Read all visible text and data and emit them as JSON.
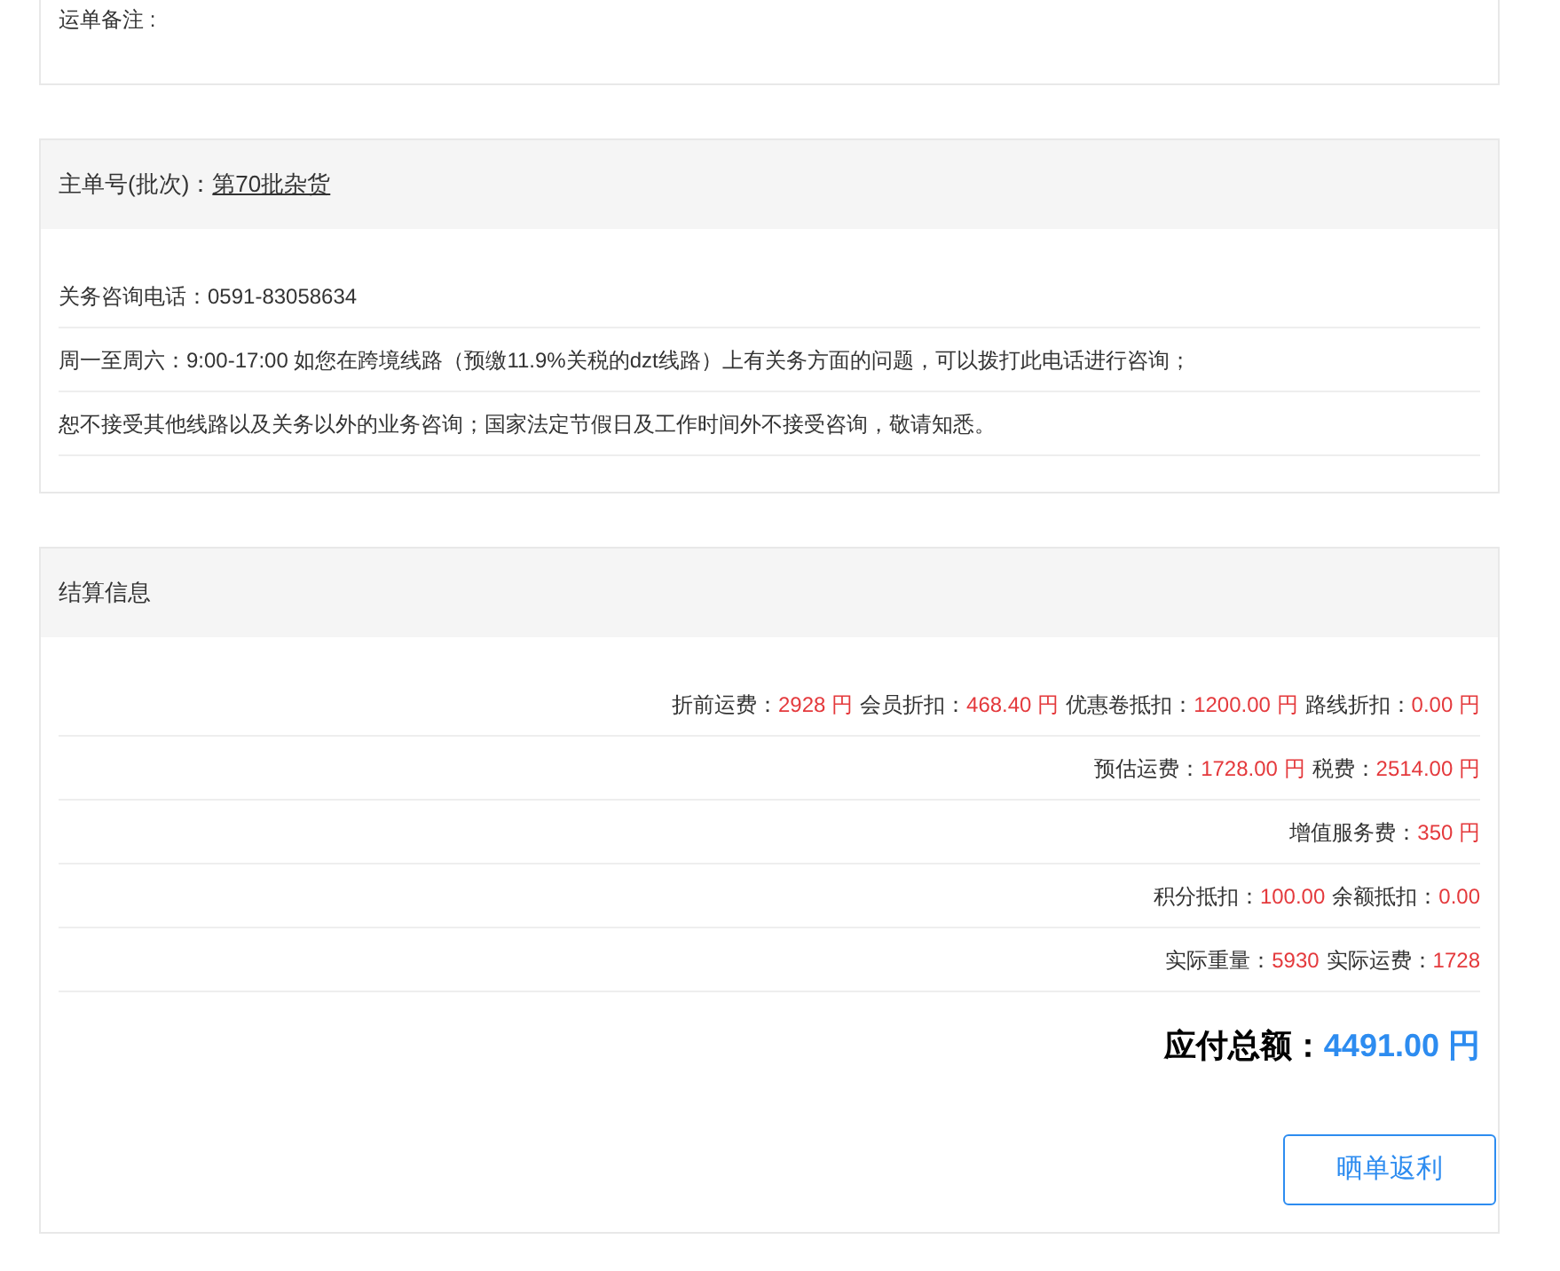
{
  "remarks": {
    "label": "运单备注 :"
  },
  "batch": {
    "label": "主单号(批次)：",
    "link": "第70批杂货",
    "lines": [
      "关务咨询电话：0591-83058634",
      "周一至周六：9:00-17:00 如您在跨境线路（预缴11.9%关税的dzt线路）上有关务方面的问题，可以拨打此电话进行咨询；",
      "恕不接受其他线路以及关务以外的业务咨询；国家法定节假日及工作时间外不接受咨询，敬请知悉。"
    ]
  },
  "settlement": {
    "title": "结算信息",
    "rows": [
      [
        {
          "label": "折前运费：",
          "value": "2928 円"
        },
        {
          "label": "会员折扣：",
          "value": "468.40 円"
        },
        {
          "label": "优惠卷抵扣：",
          "value": "1200.00 円"
        },
        {
          "label": "路线折扣：",
          "value": "0.00 円"
        }
      ],
      [
        {
          "label": "预估运费：",
          "value": "1728.00 円"
        },
        {
          "label": "税费：",
          "value": "2514.00 円"
        }
      ],
      [
        {
          "label": "增值服务费：",
          "value": "350 円"
        }
      ],
      [
        {
          "label": "积分抵扣：",
          "value": "100.00"
        },
        {
          "label": "余额抵扣：",
          "value": "0.00"
        }
      ],
      [
        {
          "label": "实际重量：",
          "value": "5930"
        },
        {
          "label": "实际运费：",
          "value": "1728"
        }
      ]
    ],
    "total_label": "应付总额：",
    "total_value": "4491.00 円",
    "button": "晒单返利"
  }
}
